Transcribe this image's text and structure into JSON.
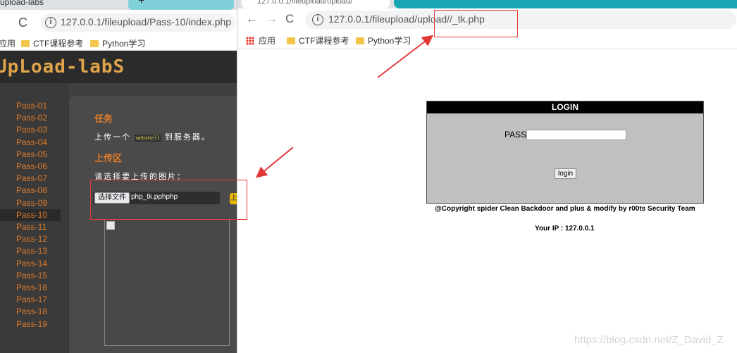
{
  "left_browser": {
    "tab_title": "upload-labs",
    "new_tab_glyph": "+",
    "reload_glyph": "C",
    "url": "127.0.0.1/fileupload/Pass-10/index.php",
    "bookmarks": [
      {
        "label": "应用"
      },
      {
        "label": "CTF课程参考"
      },
      {
        "label": "Python学习"
      }
    ],
    "page": {
      "logo": "UpLoad-labS",
      "nav": [
        "Pass-01",
        "Pass-02",
        "Pass-03",
        "Pass-04",
        "Pass-05",
        "Pass-06",
        "Pass-07",
        "Pass-08",
        "Pass-09",
        "Pass-10",
        "Pass-11",
        "Pass-12",
        "Pass-13",
        "Pass-14",
        "Pass-15",
        "Pass-16",
        "Pass-17",
        "Pass-18",
        "Pass-19"
      ],
      "active_nav": "Pass-10",
      "task_title": "任务",
      "task_text_before": "上传一个",
      "task_code": "webshell",
      "task_text_after": "到服务器。",
      "upload_title": "上传区",
      "upload_prompt": "请选择要上传的图片：",
      "choose_file_label": "选择文件",
      "chosen_file": "php_tk.pphphp",
      "upload_button_glyph": "上"
    }
  },
  "right_browser": {
    "tab_title": "127.0.0.1/fileupload/upload/",
    "back_glyph": "←",
    "forward_glyph": "→",
    "reload_glyph": "C",
    "url": "127.0.0.1/fileupload/upload//_tk.php",
    "bookmarks": [
      {
        "label": "应用"
      },
      {
        "label": "CTF课程参考"
      },
      {
        "label": "Python学习"
      }
    ],
    "page": {
      "login_title": "LOGIN",
      "pass_label": "PASS:",
      "pass_value": "",
      "login_button": "login",
      "copyright": "@Copyright spider Clean Backdoor and plus & modify by r00ts Security Team",
      "your_ip": "Your IP : 127.0.0.1"
    }
  },
  "watermark": "https://blog.csdn.net/Z_David_Z",
  "annotation_color": "#e23a3a"
}
